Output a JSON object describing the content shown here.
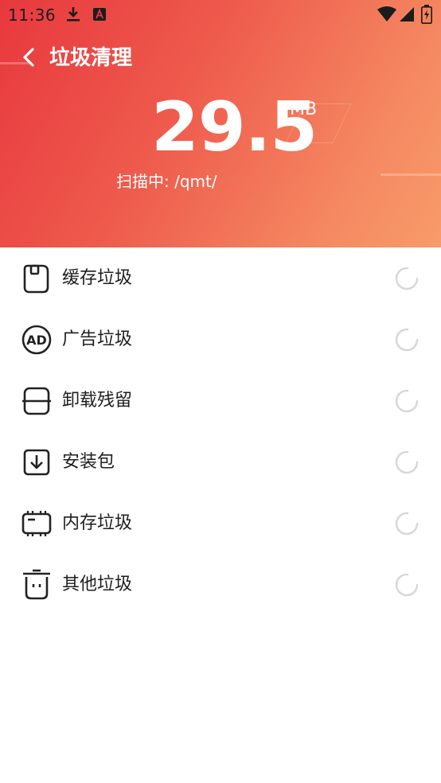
{
  "status_bar": {
    "time": "11:36",
    "icons": [
      "download-icon",
      "app-notification-icon",
      "wifi-icon",
      "signal-icon",
      "battery-icon"
    ]
  },
  "header": {
    "back_icon": "chevron-left-icon",
    "title": "垃圾清理",
    "size_value": "29.5",
    "size_unit": "MB",
    "scan_status": "扫描中: /qmt/"
  },
  "categories": [
    {
      "label": "缓存垃圾",
      "icon": "cache-icon",
      "status": "loading"
    },
    {
      "label": "广告垃圾",
      "icon": "ad-icon",
      "status": "loading"
    },
    {
      "label": "卸载残留",
      "icon": "uninstall-residue-icon",
      "status": "loading"
    },
    {
      "label": "安装包",
      "icon": "install-package-icon",
      "status": "loading"
    },
    {
      "label": "内存垃圾",
      "icon": "memory-icon",
      "status": "loading"
    },
    {
      "label": "其他垃圾",
      "icon": "trash-icon",
      "status": "loading"
    }
  ],
  "colors": {
    "gradient_start": "#e8383e",
    "gradient_end": "#f89b6a",
    "text_primary": "#1e1e1e",
    "spinner": "#d8d8d8"
  }
}
